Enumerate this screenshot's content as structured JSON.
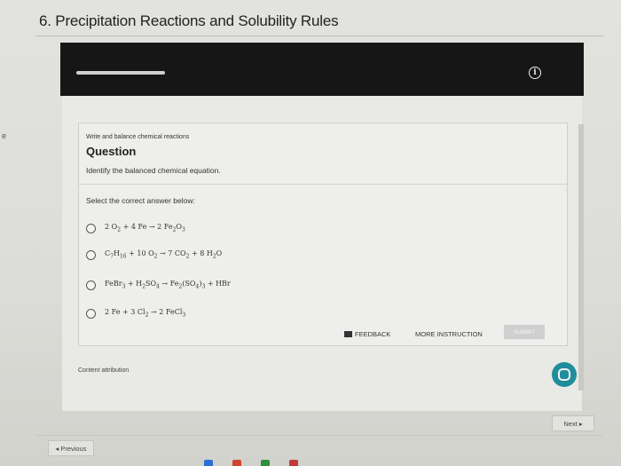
{
  "page": {
    "title": "6. Precipitation Reactions and Solubility Rules",
    "left_edge_glyph": "e"
  },
  "header": {
    "progress": 0.17,
    "info_icon": "info-icon"
  },
  "question": {
    "kicker": "Write and balance chemical reactions",
    "heading": "Question",
    "prompt": "Identify the balanced chemical equation.",
    "select_label": "Select the correct answer below:",
    "options": [
      {
        "html": "2 O<sub>2</sub> + 4 Fe → 2 Fe<sub>2</sub>O<sub>3</sub>"
      },
      {
        "html": "C<sub>7</sub>H<sub>16</sub> + 10 O<sub>2</sub> → 7 CO<sub>2</sub> + 8 H<sub>2</sub>O"
      },
      {
        "html": "FeBr<sub>3</sub> + H<sub>2</sub>SO<sub>4</sub> → Fe<sub>2</sub>(SO<sub>4</sub>)<sub>3</sub> + HBr"
      },
      {
        "html": "2 Fe + 3 Cl<sub>2</sub> → 2 FeCl<sub>3</sub>"
      }
    ]
  },
  "actions": {
    "feedback_label": "FEEDBACK",
    "more_instruction_label": "MORE INSTRUCTION",
    "submit_label": "SUBMIT"
  },
  "footer": {
    "content_attribution": "Content attribution",
    "next_label": "Next ▸",
    "previous_label": "◂ Previous"
  },
  "colors": {
    "header_band": "#161616",
    "chat_button": "#1f8d9b"
  }
}
